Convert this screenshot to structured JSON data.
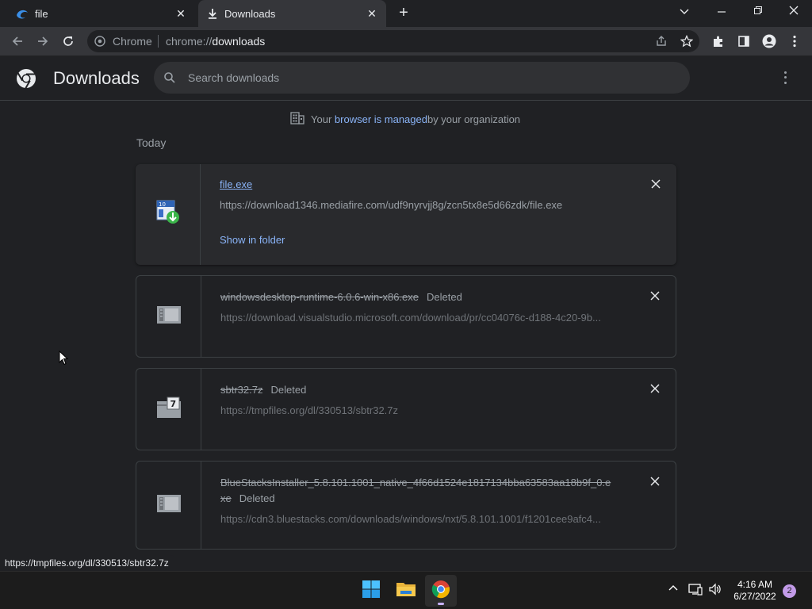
{
  "tabs": [
    {
      "title": "file",
      "active": false
    },
    {
      "title": "Downloads",
      "active": true
    }
  ],
  "toolbar": {
    "site_chip": "Chrome",
    "url_scheme": "chrome://",
    "url_host": "downloads"
  },
  "header": {
    "title": "Downloads",
    "search_placeholder": "Search downloads"
  },
  "managed_notice": {
    "prefix": "Your ",
    "link": "browser is managed",
    "suffix": " by your organization"
  },
  "section_label": "Today",
  "downloads": [
    {
      "name": "file.exe",
      "status": "",
      "url": "https://download1346.mediafire.com/udf9nyrvjj8g/zcn5tx8e5d66zdk/file.exe",
      "action": "Show in folder",
      "icon": "installer-icon"
    },
    {
      "name": "windowsdesktop-runtime-6.0.6-win-x86.exe",
      "status": "Deleted",
      "url": "https://download.visualstudio.microsoft.com/download/pr/cc04076c-d188-4c20-9b...",
      "icon": "generic-file-icon"
    },
    {
      "name": "sbtr32.7z",
      "status": "Deleted",
      "url": "https://tmpfiles.org/dl/330513/sbtr32.7z",
      "icon": "archive-file-icon"
    },
    {
      "name": "BlueStacksInstaller_5.8.101.1001_native_4f66d1524e1817134bba63583aa18b9f_0.e",
      "name_cont": "xe",
      "status": "Deleted",
      "url": "https://cdn3.bluestacks.com/downloads/windows/nxt/5.8.101.1001/f1201cee9afc4...",
      "icon": "generic-file-icon"
    }
  ],
  "status_bubble": "https://tmpfiles.org/dl/330513/sbtr32.7z",
  "taskbar": {
    "time": "4:16 AM",
    "date": "6/27/2022",
    "notification_count": "2"
  },
  "colors": {
    "background": "#202124",
    "toolbar": "#35363a",
    "link": "#8ab4f8",
    "muted_text": "#9aa0a6"
  }
}
